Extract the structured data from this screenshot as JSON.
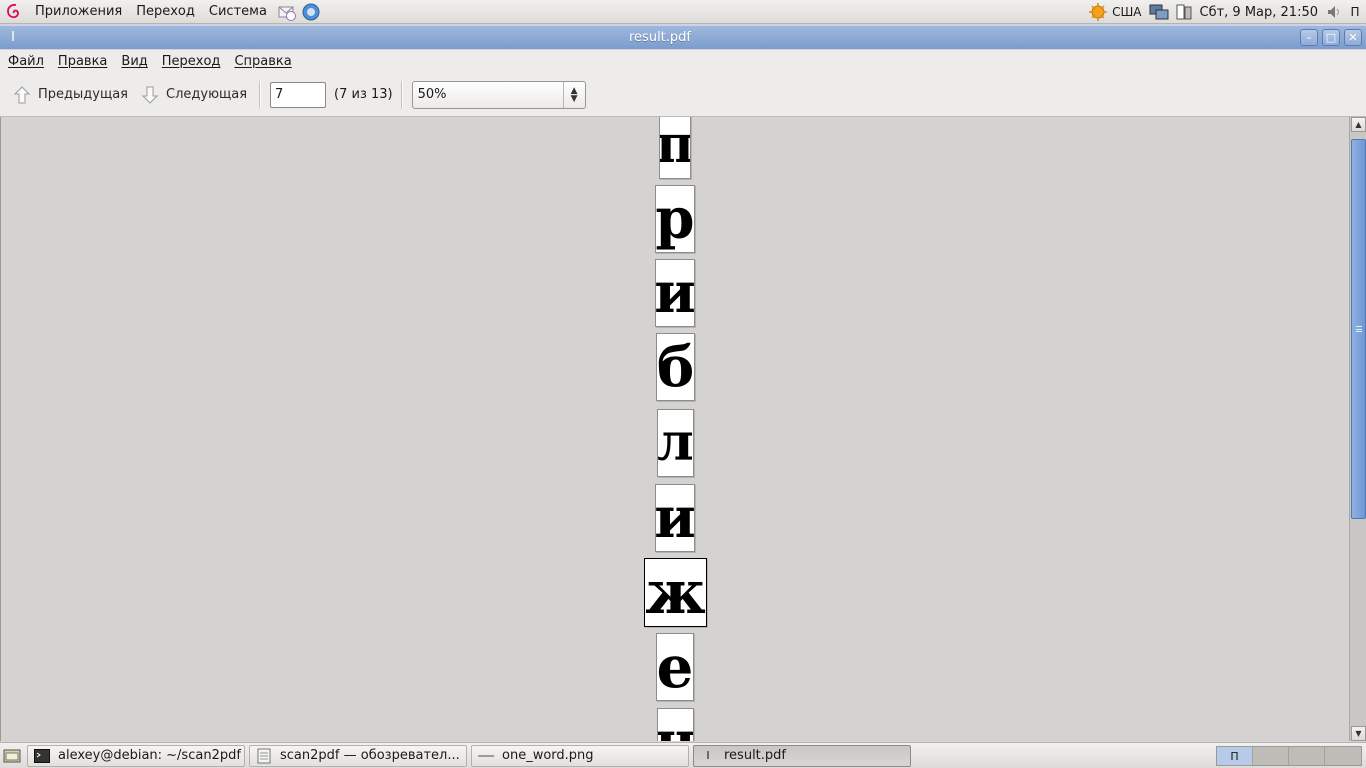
{
  "top_panel": {
    "menus": [
      "Приложения",
      "Переход",
      "Система"
    ],
    "keyboard_layout": "США",
    "clock": "Сбт,  9 Мар, 21:50",
    "show_desktop_glyph": "П"
  },
  "window": {
    "icon_glyph": "I",
    "title": "result.pdf",
    "controls": {
      "minimize": "–",
      "maximize": "□",
      "close": "✕"
    }
  },
  "menubar": [
    "Файл",
    "Правка",
    "Вид",
    "Переход",
    "Справка"
  ],
  "toolbar": {
    "prev_label": "Предыдущая",
    "next_label": "Следующая",
    "page_value": "7",
    "page_count": "(7 из 13)",
    "zoom_value": "50%"
  },
  "pages": [
    {
      "glyph": "п"
    },
    {
      "glyph": "р"
    },
    {
      "glyph": "и"
    },
    {
      "glyph": "б"
    },
    {
      "glyph": "л"
    },
    {
      "glyph": "и"
    },
    {
      "glyph": "ж"
    },
    {
      "glyph": "е"
    },
    {
      "glyph": "н"
    }
  ],
  "taskbar": {
    "tasks": [
      {
        "label": "alexey@debian: ~/scan2pdf",
        "icon": "terminal-icon"
      },
      {
        "label": "scan2pdf — обозревател...",
        "icon": "file-browser-icon"
      },
      {
        "label": "one_word.png",
        "icon": "image-icon"
      },
      {
        "label": "result.pdf",
        "icon": "document-icon"
      }
    ],
    "workspace_glyph": "П"
  },
  "colors": {
    "titlebar": "#7b9ccd",
    "scroll_thumb": "#6f97d3",
    "doc_background": "#d4d3d1"
  }
}
